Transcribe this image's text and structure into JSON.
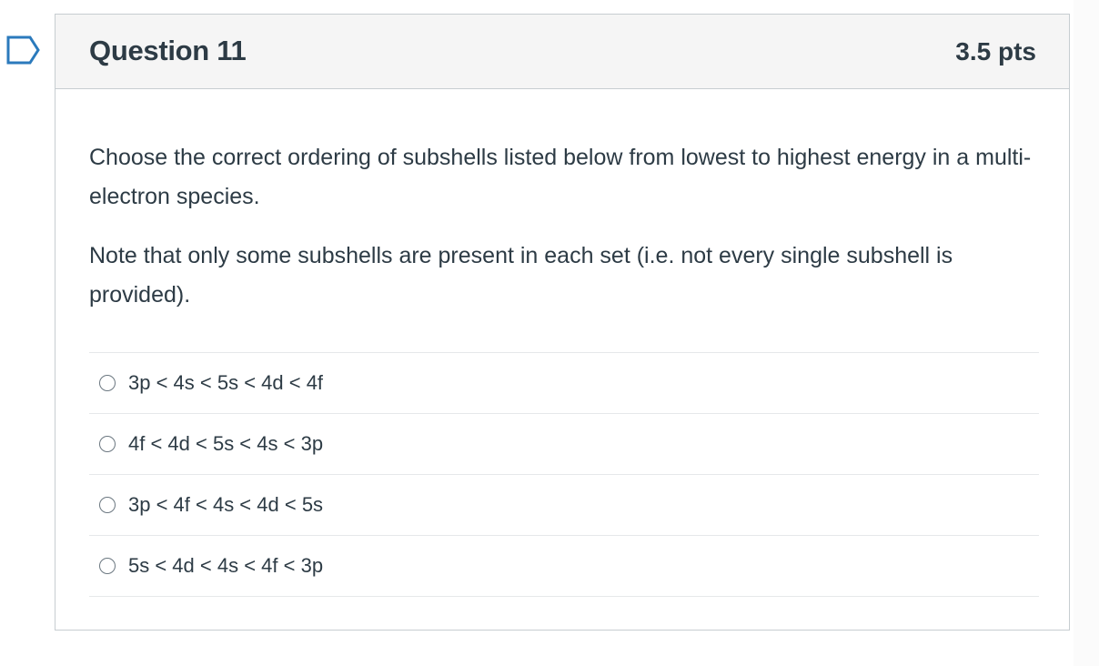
{
  "question": {
    "title": "Question 11",
    "points": "3.5 pts",
    "paragraphs": [
      "Choose the correct ordering of subshells listed below from lowest to highest energy in a multi-electron species.",
      "Note that only some subshells are present in each set (i.e. not every single subshell is provided)."
    ],
    "answers": [
      "3p < 4s < 5s < 4d < 4f",
      "4f < 4d < 5s < 4s < 3p",
      "3p < 4f < 4s < 4d < 5s",
      "5s < 4d < 4s < 4f < 3p"
    ],
    "selected_answer": null,
    "flag_icon": "bookmark-flag-icon"
  },
  "colors": {
    "text": "#2d3b45",
    "header_bg": "#f5f5f5",
    "border": "#c7cdd1",
    "divider": "#e6e8ea",
    "flag": "#2b7abc"
  }
}
